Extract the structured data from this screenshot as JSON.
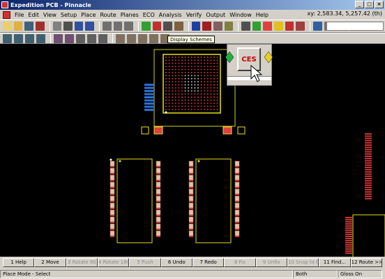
{
  "window": {
    "title": "Expedition PCB - Pinnacle",
    "controls": [
      "_",
      "□",
      "×"
    ]
  },
  "menu": {
    "items": [
      "File",
      "Edit",
      "View",
      "Setup",
      "Place",
      "Route",
      "Planes",
      "ECO",
      "Analysis",
      "Verify",
      "Output",
      "Window",
      "Help"
    ]
  },
  "coords": {
    "label": "xy:",
    "value": "2,583.34, 5,257.42 (th)"
  },
  "tooltip": {
    "text": "Display Schemes"
  },
  "ces_button": {
    "label": "CES"
  },
  "function_keys": [
    {
      "label": "1 Help",
      "enabled": true
    },
    {
      "label": "2 Move",
      "enabled": true
    },
    {
      "label": "3 Rotate 90",
      "enabled": false
    },
    {
      "label": "4 Rotate 180",
      "enabled": false
    },
    {
      "label": "5 Push",
      "enabled": false
    },
    {
      "label": "6 Undo",
      "enabled": true
    },
    {
      "label": "7 Redo",
      "enabled": true
    },
    {
      "label": "8 Fix",
      "enabled": false
    },
    {
      "label": "9 Unfix",
      "enabled": false
    },
    {
      "label": "10 Snap to Grid",
      "enabled": false
    },
    {
      "label": "11 Find...",
      "enabled": true
    },
    {
      "label": "12 Route >>",
      "enabled": true
    }
  ],
  "status": {
    "mode": "Place Mode - Select",
    "side": "Both",
    "gloss": "Gloss On"
  },
  "colors": {
    "canvas": "#000000",
    "outline": "#e8e020",
    "pin": "#cc3333",
    "pad": "#e8c0a0",
    "via_blue": "#2a6fd6",
    "selected": "#ff4040"
  }
}
